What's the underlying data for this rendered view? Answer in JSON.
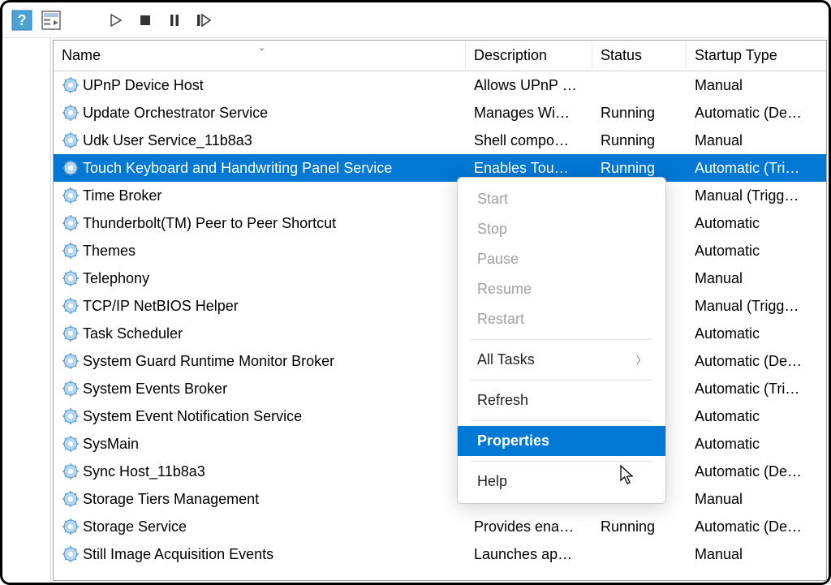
{
  "columns": {
    "name": "Name",
    "desc": "Description",
    "status": "Status",
    "startup": "Startup Type"
  },
  "rows": [
    {
      "name": "UPnP Device Host",
      "desc": "Allows UPnP …",
      "status": "",
      "startup": "Manual"
    },
    {
      "name": "Update Orchestrator Service",
      "desc": "Manages Wi…",
      "status": "Running",
      "startup": "Automatic (De…"
    },
    {
      "name": "Udk User Service_11b8a3",
      "desc": "Shell compo…",
      "status": "Running",
      "startup": "Manual"
    },
    {
      "name": "Touch Keyboard and Handwriting Panel Service",
      "desc": "Enables Tou…",
      "status": "Running",
      "startup": "Automatic (Tri…",
      "selected": true
    },
    {
      "name": "Time Broker",
      "desc": "",
      "status": "",
      "startup": "Manual (Trigg…"
    },
    {
      "name": "Thunderbolt(TM) Peer to Peer Shortcut",
      "desc": "",
      "status": "",
      "startup": "Automatic"
    },
    {
      "name": "Themes",
      "desc": "",
      "status": "",
      "startup": "Automatic"
    },
    {
      "name": "Telephony",
      "desc": "",
      "status": "",
      "startup": "Manual"
    },
    {
      "name": "TCP/IP NetBIOS Helper",
      "desc": "",
      "status": "",
      "startup": "Manual (Trigg…"
    },
    {
      "name": "Task Scheduler",
      "desc": "",
      "status": "",
      "startup": "Automatic"
    },
    {
      "name": "System Guard Runtime Monitor Broker",
      "desc": "",
      "status": "",
      "startup": "Automatic (De…"
    },
    {
      "name": "System Events Broker",
      "desc": "",
      "status": "",
      "startup": "Automatic (Tri…"
    },
    {
      "name": "System Event Notification Service",
      "desc": "",
      "status": "",
      "startup": "Automatic"
    },
    {
      "name": "SysMain",
      "desc": "",
      "status": "",
      "startup": "Automatic"
    },
    {
      "name": "Sync Host_11b8a3",
      "desc": "",
      "status": "",
      "startup": "Automatic (De…"
    },
    {
      "name": "Storage Tiers Management",
      "desc": "",
      "status": "",
      "startup": "Manual"
    },
    {
      "name": "Storage Service",
      "desc": "Provides ena…",
      "status": "Running",
      "startup": "Automatic (De…"
    },
    {
      "name": "Still Image Acquisition Events",
      "desc": "Launches ap…",
      "status": "",
      "startup": "Manual"
    }
  ],
  "menu": {
    "start": "Start",
    "stop": "Stop",
    "pause": "Pause",
    "resume": "Resume",
    "restart": "Restart",
    "all_tasks": "All Tasks",
    "refresh": "Refresh",
    "properties": "Properties",
    "help": "Help"
  }
}
